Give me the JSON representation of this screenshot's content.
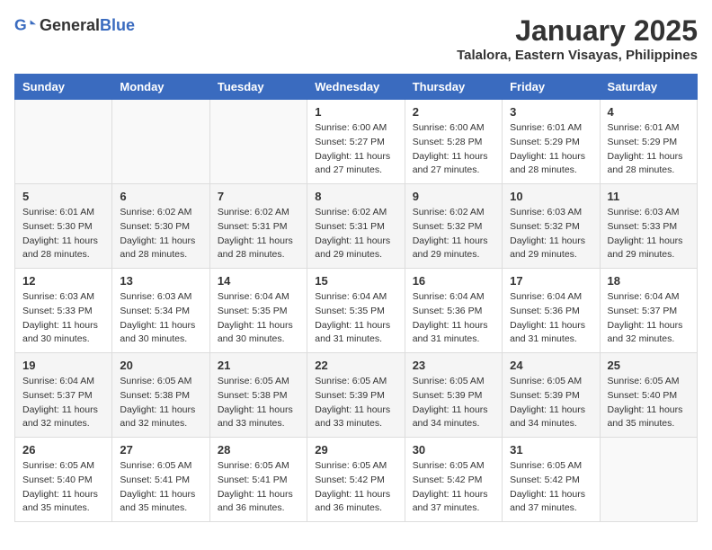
{
  "logo": {
    "text_general": "General",
    "text_blue": "Blue"
  },
  "title": "January 2025",
  "subtitle": "Talalora, Eastern Visayas, Philippines",
  "days_of_week": [
    "Sunday",
    "Monday",
    "Tuesday",
    "Wednesday",
    "Thursday",
    "Friday",
    "Saturday"
  ],
  "weeks": [
    [
      {
        "day": "",
        "info": ""
      },
      {
        "day": "",
        "info": ""
      },
      {
        "day": "",
        "info": ""
      },
      {
        "day": "1",
        "info": "Sunrise: 6:00 AM\nSunset: 5:27 PM\nDaylight: 11 hours\nand 27 minutes."
      },
      {
        "day": "2",
        "info": "Sunrise: 6:00 AM\nSunset: 5:28 PM\nDaylight: 11 hours\nand 27 minutes."
      },
      {
        "day": "3",
        "info": "Sunrise: 6:01 AM\nSunset: 5:29 PM\nDaylight: 11 hours\nand 28 minutes."
      },
      {
        "day": "4",
        "info": "Sunrise: 6:01 AM\nSunset: 5:29 PM\nDaylight: 11 hours\nand 28 minutes."
      }
    ],
    [
      {
        "day": "5",
        "info": "Sunrise: 6:01 AM\nSunset: 5:30 PM\nDaylight: 11 hours\nand 28 minutes."
      },
      {
        "day": "6",
        "info": "Sunrise: 6:02 AM\nSunset: 5:30 PM\nDaylight: 11 hours\nand 28 minutes."
      },
      {
        "day": "7",
        "info": "Sunrise: 6:02 AM\nSunset: 5:31 PM\nDaylight: 11 hours\nand 28 minutes."
      },
      {
        "day": "8",
        "info": "Sunrise: 6:02 AM\nSunset: 5:31 PM\nDaylight: 11 hours\nand 29 minutes."
      },
      {
        "day": "9",
        "info": "Sunrise: 6:02 AM\nSunset: 5:32 PM\nDaylight: 11 hours\nand 29 minutes."
      },
      {
        "day": "10",
        "info": "Sunrise: 6:03 AM\nSunset: 5:32 PM\nDaylight: 11 hours\nand 29 minutes."
      },
      {
        "day": "11",
        "info": "Sunrise: 6:03 AM\nSunset: 5:33 PM\nDaylight: 11 hours\nand 29 minutes."
      }
    ],
    [
      {
        "day": "12",
        "info": "Sunrise: 6:03 AM\nSunset: 5:33 PM\nDaylight: 11 hours\nand 30 minutes."
      },
      {
        "day": "13",
        "info": "Sunrise: 6:03 AM\nSunset: 5:34 PM\nDaylight: 11 hours\nand 30 minutes."
      },
      {
        "day": "14",
        "info": "Sunrise: 6:04 AM\nSunset: 5:35 PM\nDaylight: 11 hours\nand 30 minutes."
      },
      {
        "day": "15",
        "info": "Sunrise: 6:04 AM\nSunset: 5:35 PM\nDaylight: 11 hours\nand 31 minutes."
      },
      {
        "day": "16",
        "info": "Sunrise: 6:04 AM\nSunset: 5:36 PM\nDaylight: 11 hours\nand 31 minutes."
      },
      {
        "day": "17",
        "info": "Sunrise: 6:04 AM\nSunset: 5:36 PM\nDaylight: 11 hours\nand 31 minutes."
      },
      {
        "day": "18",
        "info": "Sunrise: 6:04 AM\nSunset: 5:37 PM\nDaylight: 11 hours\nand 32 minutes."
      }
    ],
    [
      {
        "day": "19",
        "info": "Sunrise: 6:04 AM\nSunset: 5:37 PM\nDaylight: 11 hours\nand 32 minutes."
      },
      {
        "day": "20",
        "info": "Sunrise: 6:05 AM\nSunset: 5:38 PM\nDaylight: 11 hours\nand 32 minutes."
      },
      {
        "day": "21",
        "info": "Sunrise: 6:05 AM\nSunset: 5:38 PM\nDaylight: 11 hours\nand 33 minutes."
      },
      {
        "day": "22",
        "info": "Sunrise: 6:05 AM\nSunset: 5:39 PM\nDaylight: 11 hours\nand 33 minutes."
      },
      {
        "day": "23",
        "info": "Sunrise: 6:05 AM\nSunset: 5:39 PM\nDaylight: 11 hours\nand 34 minutes."
      },
      {
        "day": "24",
        "info": "Sunrise: 6:05 AM\nSunset: 5:39 PM\nDaylight: 11 hours\nand 34 minutes."
      },
      {
        "day": "25",
        "info": "Sunrise: 6:05 AM\nSunset: 5:40 PM\nDaylight: 11 hours\nand 35 minutes."
      }
    ],
    [
      {
        "day": "26",
        "info": "Sunrise: 6:05 AM\nSunset: 5:40 PM\nDaylight: 11 hours\nand 35 minutes."
      },
      {
        "day": "27",
        "info": "Sunrise: 6:05 AM\nSunset: 5:41 PM\nDaylight: 11 hours\nand 35 minutes."
      },
      {
        "day": "28",
        "info": "Sunrise: 6:05 AM\nSunset: 5:41 PM\nDaylight: 11 hours\nand 36 minutes."
      },
      {
        "day": "29",
        "info": "Sunrise: 6:05 AM\nSunset: 5:42 PM\nDaylight: 11 hours\nand 36 minutes."
      },
      {
        "day": "30",
        "info": "Sunrise: 6:05 AM\nSunset: 5:42 PM\nDaylight: 11 hours\nand 37 minutes."
      },
      {
        "day": "31",
        "info": "Sunrise: 6:05 AM\nSunset: 5:42 PM\nDaylight: 11 hours\nand 37 minutes."
      },
      {
        "day": "",
        "info": ""
      }
    ]
  ]
}
